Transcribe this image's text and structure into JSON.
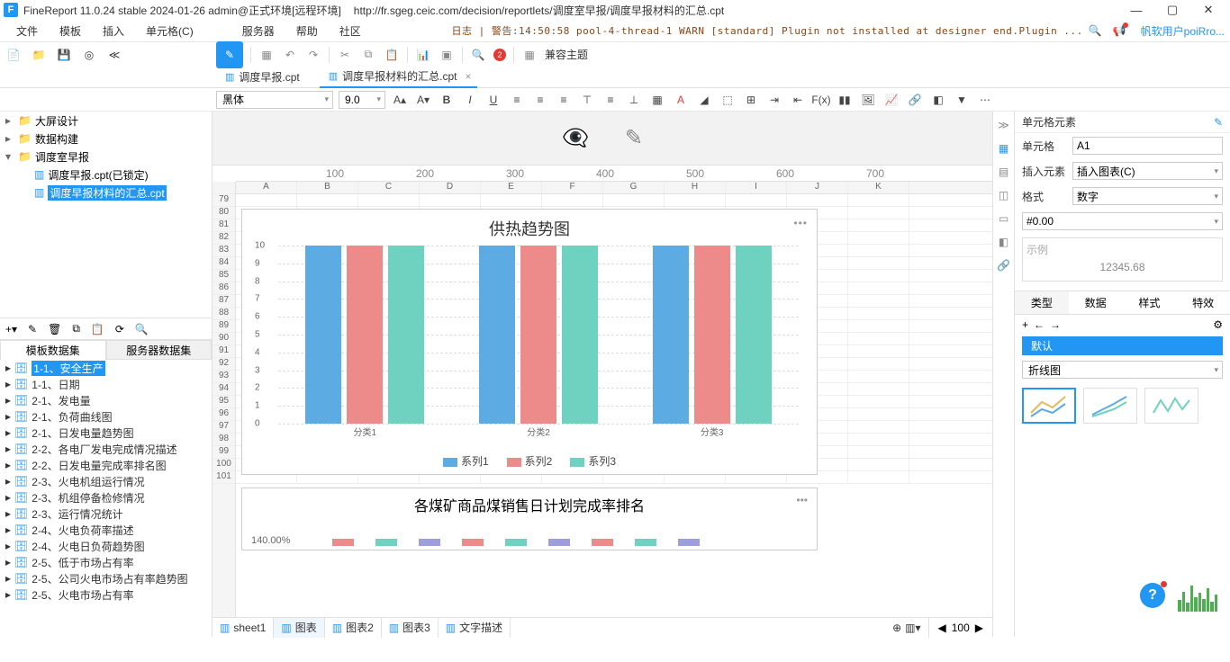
{
  "titlebar": {
    "app": "FineReport 11.0.24 stable 2024-01-26 admin@正式环境[远程环境]",
    "path": "http://fr.sgeg.ceic.com/decision/reportlets/调度室早报/调度早报材料的汇总.cpt"
  },
  "menu": {
    "file": "文件",
    "template": "模板",
    "insert": "插入",
    "cell": "单元格(C)",
    "server": "服务器",
    "help": "帮助",
    "community": "社区"
  },
  "log": "日志 | 警告:14:50:58 pool-4-thread-1 WARN [standard] Plugin not installed at designer end.Plugin ...",
  "user": "帆软用户poiRro...",
  "compat_theme": "兼容主题",
  "toolbar_badge": "2",
  "tabs": [
    {
      "icon": "F",
      "label": "调度早报.cpt"
    },
    {
      "icon": "F",
      "label": "调度早报材料的汇总.cpt",
      "active": true,
      "close": "×"
    }
  ],
  "format": {
    "font": "黑体",
    "size": "9.0"
  },
  "tree": [
    {
      "indent": 0,
      "exp": "▸",
      "type": "folder",
      "label": "大屏设计"
    },
    {
      "indent": 0,
      "exp": "▸",
      "type": "folder",
      "label": "数据构建"
    },
    {
      "indent": 0,
      "exp": "▾",
      "type": "folder",
      "label": "调度室早报"
    },
    {
      "indent": 1,
      "exp": "",
      "type": "doc",
      "label": "调度早报.cpt(已锁定)"
    },
    {
      "indent": 1,
      "exp": "",
      "type": "doc",
      "label": "调度早报材料的汇总.cpt",
      "selected": true
    }
  ],
  "ds_tabs": {
    "a": "模板数据集",
    "b": "服务器数据集"
  },
  "ds_list": [
    {
      "label": "1-1、安全生产",
      "selected": true
    },
    {
      "label": "1-1、日期"
    },
    {
      "label": "2-1、发电量"
    },
    {
      "label": "2-1、负荷曲线图"
    },
    {
      "label": "2-1、日发电量趋势图"
    },
    {
      "label": "2-2、各电厂发电完成情况描述"
    },
    {
      "label": "2-2、日发电量完成率排名图"
    },
    {
      "label": "2-3、火电机组运行情况"
    },
    {
      "label": "2-3、机组停备检修情况"
    },
    {
      "label": "2-3、运行情况统计"
    },
    {
      "label": "2-4、火电负荷率描述"
    },
    {
      "label": "2-4、火电日负荷趋势图"
    },
    {
      "label": "2-5、低于市场占有率"
    },
    {
      "label": "2-5、公司火电市场占有率趋势图"
    },
    {
      "label": "2-5、火电市场占有率"
    }
  ],
  "cols": [
    "A",
    "B",
    "C",
    "D",
    "E",
    "F",
    "G",
    "H",
    "I",
    "J",
    "K"
  ],
  "rows": [
    "79",
    "80",
    "81",
    "82",
    "83",
    "84",
    "85",
    "86",
    "87",
    "88",
    "89",
    "90",
    "91",
    "92",
    "93",
    "94",
    "95",
    "96",
    "97",
    "98",
    "99",
    "100",
    "101"
  ],
  "ruler": {
    "p1": "100",
    "p2": "200",
    "p3": "300",
    "p4": "400",
    "p5": "500",
    "p6": "600",
    "p7": "700"
  },
  "chart_data": {
    "type": "bar",
    "title": "供热趋势图",
    "categories": [
      "分类1",
      "分类2",
      "分类3"
    ],
    "series": [
      {
        "name": "系列1",
        "values": [
          10,
          10,
          10
        ],
        "color": "#5DABE3"
      },
      {
        "name": "系列2",
        "values": [
          10,
          10,
          10
        ],
        "color": "#EC8B89"
      },
      {
        "name": "系列3",
        "values": [
          10,
          10,
          10
        ],
        "color": "#6FD1BF"
      }
    ],
    "ylim": [
      0,
      10
    ],
    "yticks": [
      0,
      1,
      2,
      3,
      4,
      5,
      6,
      7,
      8,
      9,
      10
    ]
  },
  "chart2": {
    "title": "各煤矿商品煤销售日计划完成率排名",
    "pct": "140.00%"
  },
  "sheet_tabs": [
    "sheet1",
    "图表",
    "图表2",
    "图表3",
    "文字描述"
  ],
  "zoom": "100",
  "right": {
    "title": "单元格元素",
    "cell_label": "单元格",
    "cell": "A1",
    "insert_label": "插入元素",
    "insert": "插入图表(C)",
    "format_label": "格式",
    "format": "数字",
    "numfmt": "#0.00",
    "example_label": "示例",
    "example": "12345.68",
    "tabs": {
      "type": "类型",
      "data": "数据",
      "style": "样式",
      "effect": "特效"
    },
    "default": "默认",
    "chart_type": "折线图"
  }
}
